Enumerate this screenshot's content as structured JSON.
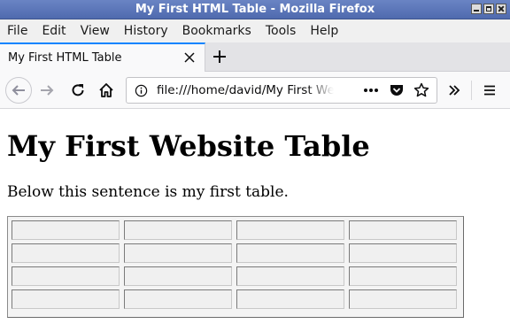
{
  "window": {
    "title": "My First HTML Table - Mozilla Firefox"
  },
  "menubar": {
    "items": [
      "File",
      "Edit",
      "View",
      "History",
      "Bookmarks",
      "Tools",
      "Help"
    ]
  },
  "tabs": [
    {
      "label": "My First HTML Table",
      "active": true
    }
  ],
  "navbar": {
    "url": "file:///home/david/My First Website Table.html"
  },
  "page": {
    "heading": "My First Website Table",
    "paragraph": "Below this sentence is my first table.",
    "table": {
      "rows": 4,
      "cols": 4,
      "cells": [
        [
          "",
          "",
          "",
          ""
        ],
        [
          "",
          "",
          "",
          ""
        ],
        [
          "",
          "",
          "",
          ""
        ],
        [
          "",
          "",
          "",
          ""
        ]
      ]
    }
  },
  "colors": {
    "titlebar": "#5570b5",
    "tab_accent": "#0a84ff"
  },
  "icons": {
    "back": "back-arrow-icon",
    "forward": "forward-arrow-icon",
    "reload": "reload-icon",
    "home": "home-icon",
    "info": "info-icon",
    "page_actions": "ellipsis-icon",
    "pocket": "pocket-icon",
    "bookmark": "star-icon",
    "overflow": "chevron-double-right-icon",
    "menu": "hamburger-menu-icon"
  }
}
